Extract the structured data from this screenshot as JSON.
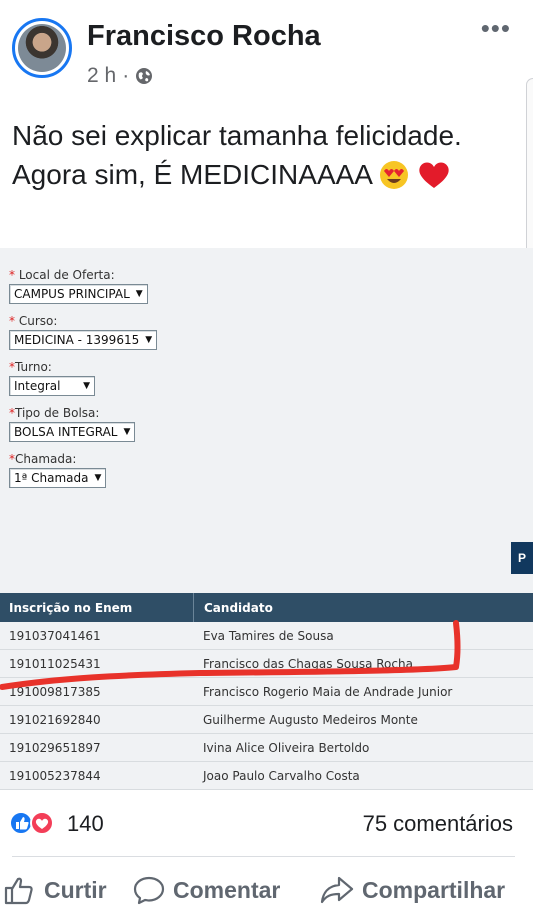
{
  "post": {
    "author": "Francisco Rocha",
    "time": "2 h",
    "separator": "·",
    "text": "Não sei explicar tamanha felicidade. Agora sim, É MEDICINAAAA",
    "text_emojis": [
      "smiling-face-with-heart-eyes",
      "red-heart"
    ]
  },
  "screenshot": {
    "form": {
      "fields": [
        {
          "label": "Local de Oferta:",
          "value": "CAMPUS PRINCIPAL"
        },
        {
          "label": "Curso:",
          "value": "MEDICINA - 1399615"
        },
        {
          "label": "Turno:",
          "value": "Integral"
        },
        {
          "label": "Tipo de Bolsa:",
          "value": "BOLSA INTEGRAL"
        },
        {
          "label": "Chamada:",
          "value": "1ª Chamada"
        }
      ],
      "required_mark": "*"
    },
    "side_button": "P",
    "table": {
      "headers": [
        "Inscrição no Enem",
        "Candidato"
      ],
      "rows": [
        [
          "191037041461",
          "Eva Tamires de Sousa"
        ],
        [
          "191011025431",
          "Francisco das Chagas Sousa Rocha"
        ],
        [
          "191009817385",
          "Francisco Rogerio Maia de Andrade Junior"
        ],
        [
          "191021692840",
          "Guilherme Augusto Medeiros Monte"
        ],
        [
          "191029651897",
          "Ivina Alice Oliveira Bertoldo"
        ],
        [
          "191005237844",
          "Joao Paulo Carvalho Costa"
        ]
      ]
    }
  },
  "stats": {
    "reactions_count": "140",
    "comments": "75 comentários"
  },
  "actions": {
    "like": "Curtir",
    "comment": "Comentar",
    "share": "Compartilhar"
  },
  "colors": {
    "facebook_blue": "#1877f2",
    "love_red": "#f33e58",
    "marker_red": "#e8322a",
    "table_header": "#2f4e66"
  },
  "icons": [
    "more-icon",
    "globe-icon",
    "like-reaction-icon",
    "love-reaction-icon",
    "thumbs-up-icon",
    "comment-icon",
    "share-icon"
  ]
}
